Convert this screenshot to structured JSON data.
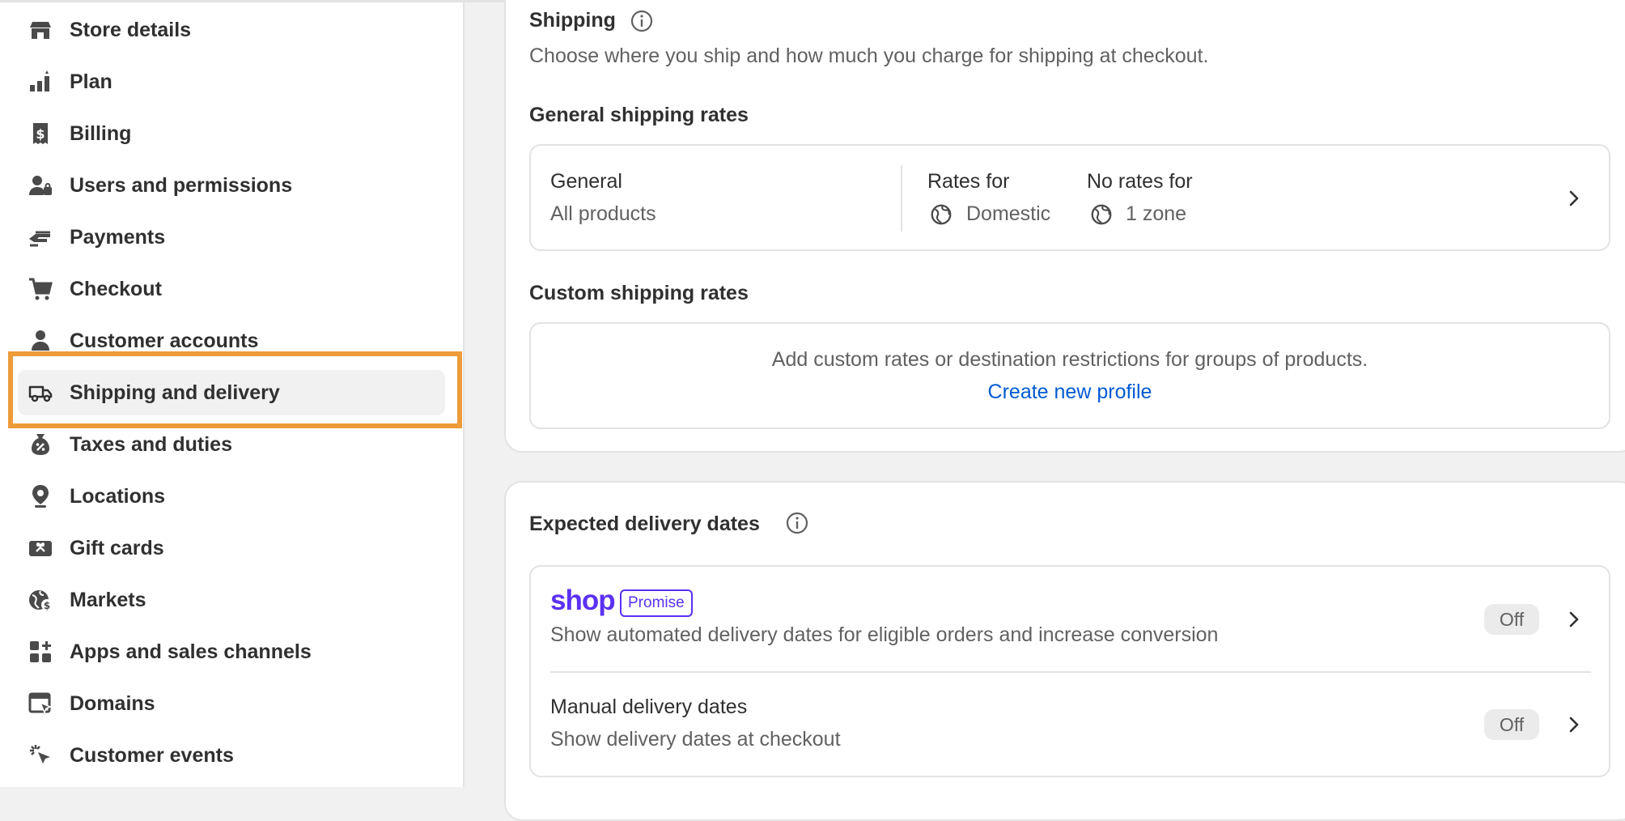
{
  "sidebar": {
    "items": [
      {
        "label": "Store details",
        "icon": "store-icon"
      },
      {
        "label": "Plan",
        "icon": "plan-icon"
      },
      {
        "label": "Billing",
        "icon": "billing-icon"
      },
      {
        "label": "Users and permissions",
        "icon": "users-icon"
      },
      {
        "label": "Payments",
        "icon": "payments-icon"
      },
      {
        "label": "Checkout",
        "icon": "cart-icon"
      },
      {
        "label": "Customer accounts",
        "icon": "person-icon"
      },
      {
        "label": "Shipping and delivery",
        "icon": "truck-icon",
        "active": true
      },
      {
        "label": "Taxes and duties",
        "icon": "tax-icon"
      },
      {
        "label": "Locations",
        "icon": "location-pin-icon"
      },
      {
        "label": "Gift cards",
        "icon": "gift-card-icon"
      },
      {
        "label": "Markets",
        "icon": "globe-dollar-icon"
      },
      {
        "label": "Apps and sales channels",
        "icon": "apps-icon"
      },
      {
        "label": "Domains",
        "icon": "domains-icon"
      },
      {
        "label": "Customer events",
        "icon": "cursor-click-icon"
      }
    ]
  },
  "shipping": {
    "title": "Shipping",
    "description": "Choose where you ship and how much you charge for shipping at checkout.",
    "general_heading": "General shipping rates",
    "general": {
      "name": "General",
      "products": "All products",
      "rates_for_label": "Rates for",
      "rates_for_value": "Domestic",
      "no_rates_for_label": "No rates for",
      "no_rates_for_value": "1 zone"
    },
    "custom_heading": "Custom shipping rates",
    "custom": {
      "text": "Add custom rates or destination restrictions for groups of products.",
      "link": "Create new profile"
    }
  },
  "delivery": {
    "title": "Expected delivery dates",
    "shop_logo": "shop",
    "promise_badge": "Promise",
    "shop_promise_description": "Show automated delivery dates for eligible orders and increase conversion",
    "shop_promise_status": "Off",
    "manual_title": "Manual delivery dates",
    "manual_description": "Show delivery dates at checkout",
    "manual_status": "Off"
  },
  "colors": {
    "accent_highlight": "#ee9b3a",
    "link": "#005bd3",
    "shop_purple": "#5a31f4"
  }
}
